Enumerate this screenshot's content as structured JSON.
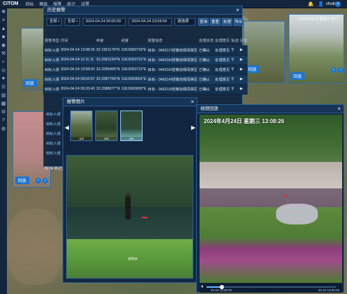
{
  "topbar": {
    "brand": "CITOM",
    "nav": [
      "目标",
      "图层",
      "报警",
      "统计",
      "设置"
    ],
    "user": "chuku"
  },
  "toolbar_icons": [
    "locate-icon",
    "layers-icon",
    "alarm-icon",
    "camera-icon",
    "measure-icon",
    "tool-icon",
    "search-icon",
    "target-icon",
    "filter-icon",
    "list-icon",
    "stats-icon",
    "grid-icon",
    "settings-icon",
    "help-icon",
    "globe-icon"
  ],
  "tiles": {
    "button_label": "回放",
    "tile_ne_title": "2024-04-24 置前2 3PT"
  },
  "alarm_panel": {
    "title": "历史报警",
    "filters": {
      "type": "全部",
      "status": "全部",
      "start": "2024-04-24 00:00:00",
      "end": "2024-04-24 23:59:59",
      "camera": "请选择"
    },
    "buttons": [
      "查询",
      "重置",
      "处理",
      "导出"
    ],
    "columns": [
      "报警类型",
      "时间",
      "纬度",
      "经度",
      "报警信息",
      "处理状态",
      "处理意见",
      "轨迹",
      "回放"
    ],
    "rows": [
      {
        "type": "目标入侵",
        "time": "2024-04-24 13:08:26",
        "lat": "32.1921179°N",
        "lon": "118.0083718°E",
        "info": "目标 - 346317/轻微违规闯禁区",
        "status": "已确认",
        "note": "处理意见"
      },
      {
        "type": "目标入侵",
        "time": "2024-04-24 11:11:11",
        "lat": "32.2091234°N",
        "lon": "118.0063721°E",
        "info": "目标 - 346316/轻微违规闯禁区",
        "status": "已确认",
        "note": "处理意见"
      },
      {
        "type": "目标入侵",
        "time": "2024-04-24 10:58:03",
        "lat": "32.2090409°N",
        "lon": "118.0063712°E",
        "info": "目标 - 346315/轻微违规闯禁区",
        "status": "已确认",
        "note": "处理意见"
      },
      {
        "type": "目标入侵",
        "time": "2024-04-24 09:52:57",
        "lat": "32.2087709°N",
        "lon": "118.0063691°E",
        "info": "目标 - 346314/轻微违规闯禁区",
        "status": "已确认",
        "note": "处理意见"
      },
      {
        "type": "目标入侵",
        "time": "2024-04-24 09:33:43",
        "lat": "32.2088077°N",
        "lon": "118.0063693°E",
        "info": "目标 - 346313/轻微违规闯禁区",
        "status": "已确认",
        "note": "处理意见"
      }
    ],
    "left_rows": [
      "目标入侵",
      "目标入侵",
      "目标入侵",
      "目标入侵",
      "目标入侵"
    ],
    "footer": "共 34 条记录"
  },
  "image_popup": {
    "title": "报警图片",
    "thumbs": [
      "1/3",
      "2/3",
      "3/3"
    ],
    "target_label": "目标A"
  },
  "video_popup": {
    "title": "视频回放",
    "overlay": "2024年4月24日 星期三 13:08:26",
    "time_start": "04-24 13:00:00",
    "time_end": "04-24 13:00:20",
    "progress": 0.12
  }
}
